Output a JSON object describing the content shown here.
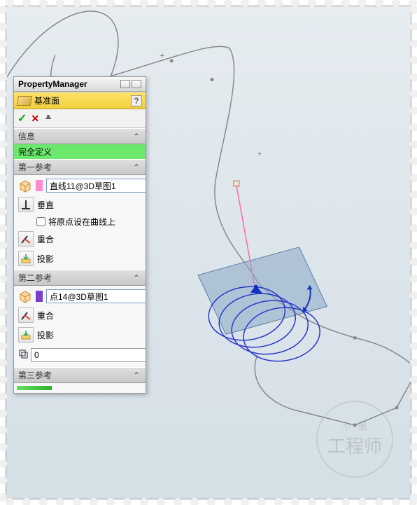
{
  "header": {
    "title": "PropertyManager"
  },
  "feature": {
    "name": "基准面",
    "help": "?"
  },
  "actions": {
    "ok": "✓",
    "cancel": "✕"
  },
  "info": {
    "header": "信息",
    "status": "完全定义"
  },
  "ref1": {
    "header": "第一参考",
    "selection": "直线11@3D草图1",
    "perpendicular": "垂直",
    "originOnCurve": "将原点设在曲线上",
    "coincident": "重合",
    "projection": "投影"
  },
  "ref2": {
    "header": "第二参考",
    "selection": "点14@3D草图1",
    "coincident": "重合",
    "projection": "投影",
    "offset": "0"
  },
  "ref3": {
    "header": "第三参考"
  },
  "watermark": {
    "small": "小 · 圈",
    "big": "工程师"
  },
  "chart_data": null
}
